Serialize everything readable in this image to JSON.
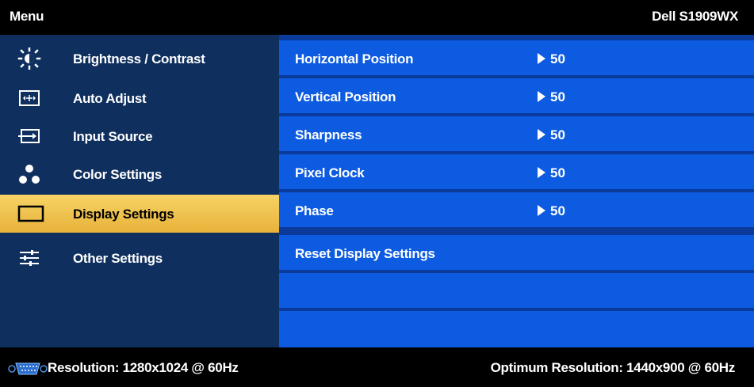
{
  "header": {
    "title": "Menu",
    "model": "Dell S1909WX"
  },
  "sidebar": {
    "items": [
      {
        "label": "Brightness / Contrast",
        "icon": "brightness-icon",
        "active": false
      },
      {
        "label": "Auto Adjust",
        "icon": "auto-adjust-icon",
        "active": false
      },
      {
        "label": "Input Source",
        "icon": "input-source-icon",
        "active": false
      },
      {
        "label": "Color Settings",
        "icon": "color-settings-icon",
        "active": false
      },
      {
        "label": "Display Settings",
        "icon": "display-settings-icon",
        "active": true
      },
      {
        "label": "Other Settings",
        "icon": "other-settings-icon",
        "active": false
      }
    ]
  },
  "settings": {
    "rows": [
      {
        "label": "Horizontal Position",
        "value": "50"
      },
      {
        "label": "Vertical Position",
        "value": "50"
      },
      {
        "label": "Sharpness",
        "value": "50"
      },
      {
        "label": "Pixel Clock",
        "value": "50"
      },
      {
        "label": "Phase",
        "value": "50"
      },
      {
        "label": "Reset Display Settings",
        "value": ""
      },
      {
        "label": "",
        "value": ""
      },
      {
        "label": "",
        "value": ""
      }
    ]
  },
  "footer": {
    "resolution": "Resolution: 1280x1024 @ 60Hz",
    "optimum": "Optimum Resolution: 1440x900 @ 60Hz",
    "connector_icon": "vga-connector-icon"
  },
  "colors": {
    "sidebar_bg": "#0f2f5e",
    "row_bg": "#0d5be0",
    "active_bg": "#f0c450",
    "divider": "#0a3a9a"
  }
}
